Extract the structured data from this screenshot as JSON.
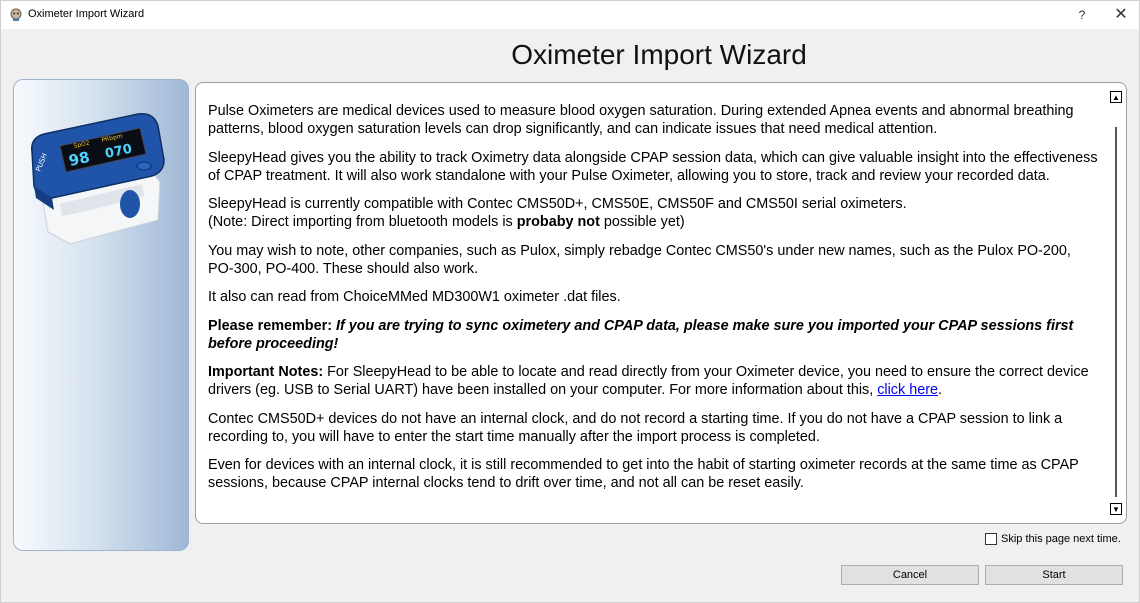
{
  "window": {
    "title": "Oximeter Import Wizard",
    "help_glyph": "?",
    "close_glyph": "✕"
  },
  "wizard": {
    "heading": "Oximeter Import Wizard"
  },
  "content": {
    "p1": "Pulse Oximeters are medical devices used to measure blood oxygen saturation. During extended Apnea events and abnormal breathing patterns, blood oxygen saturation levels can drop significantly, and can indicate issues that need medical attention.",
    "p2": "SleepyHead gives you the ability to track Oximetry data alongside CPAP session data, which can give valuable insight into the effectiveness of CPAP treatment. It will also work standalone with your Pulse Oximeter, allowing you to store, track and review your recorded data.",
    "p3_line1": "SleepyHead is currently compatible with Contec CMS50D+, CMS50E, CMS50F and CMS50I serial oximeters.",
    "p3_line2_pre": "(Note: Direct importing from bluetooth models is ",
    "p3_line2_bold": "probaby not",
    "p3_line2_post": " possible yet)",
    "p4": "You may wish to note, other companies, such as Pulox, simply rebadge Contec CMS50's under new names, such as the Pulox PO-200, PO-300, PO-400. These should also work.",
    "p5": "It also can read from ChoiceMMed MD300W1 oximeter .dat files.",
    "p6_bold": "Please remember: ",
    "p6_bolditalic": "If you are trying to sync oximetery and CPAP data, please make sure you imported your CPAP sessions first before proceeding!",
    "p7_bold": "Important Notes: ",
    "p7_text": "For SleepyHead to be able to locate and read directly from your Oximeter device, you need to ensure the correct device drivers (eg. USB to Serial UART) have been installed on your computer. For more information about this, ",
    "p7_link": "click here",
    "p7_end": ".",
    "p8": "Contec CMS50D+ devices do not have an internal clock, and do not record a starting time. If you do not have a CPAP session to link a recording to, you will have to enter the start time manually after the import process is completed.",
    "p9": "Even for devices with an internal clock, it is still recommended to get into the habit of starting oximeter records at the same time as CPAP sessions, because CPAP internal clocks tend to drift over time, and not all can be reset easily."
  },
  "device_image": {
    "label_spo2": "SpO2",
    "label_prbpm": "PRbpm",
    "reading_spo2": "98",
    "reading_pr": "070",
    "label_push": "PUSH"
  },
  "footer": {
    "skip_label": "Skip this page next time.",
    "skip_checked": false,
    "cancel_label": "Cancel",
    "start_label": "Start"
  }
}
